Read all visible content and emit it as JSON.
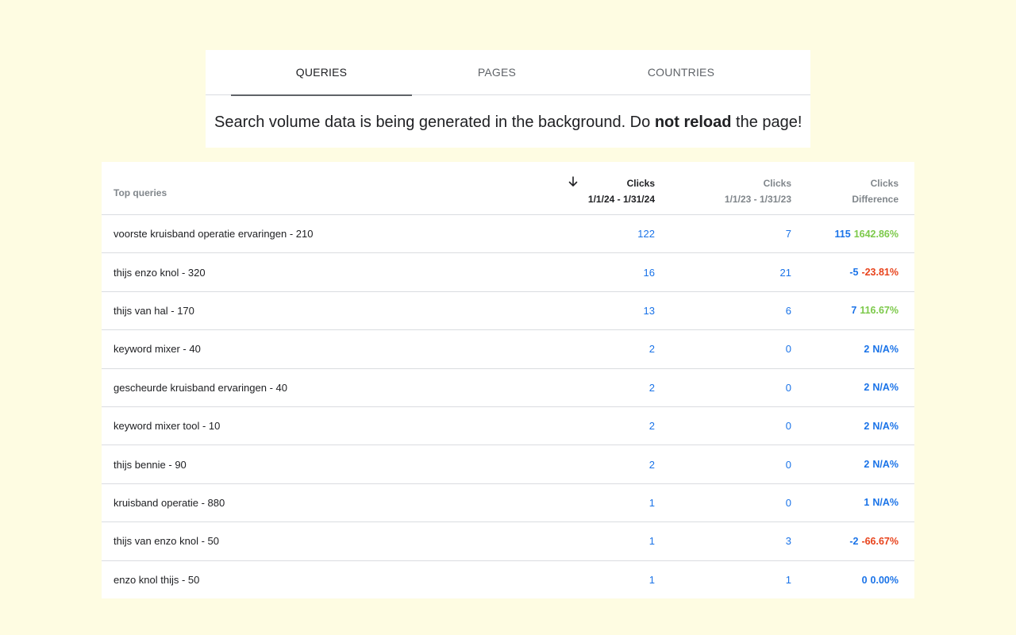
{
  "tabs": [
    {
      "label": "QUERIES",
      "active": true
    },
    {
      "label": "PAGES",
      "active": false
    },
    {
      "label": "COUNTRIES",
      "active": false
    }
  ],
  "notice": {
    "before": "Search volume data is being generated in the background. Do ",
    "bold": "not reload",
    "after": " the page!"
  },
  "table": {
    "header": {
      "query_label": "Top queries",
      "col1": {
        "title": "Clicks",
        "sub": "1/1/24 - 1/31/24"
      },
      "col2": {
        "title": "Clicks",
        "sub": "1/1/23 - 1/31/23"
      },
      "col3": {
        "title": "Clicks",
        "sub": "Difference"
      },
      "sort_icon": "arrow-down-icon"
    },
    "rows": [
      {
        "query": "voorste kruisband operatie ervaringen - 210",
        "clicks_current": "122",
        "clicks_previous": "7",
        "diff": "115",
        "pct": "1642.86%",
        "trend": "pos"
      },
      {
        "query": "thijs enzo knol - 320",
        "clicks_current": "16",
        "clicks_previous": "21",
        "diff": "-5",
        "pct": "-23.81%",
        "trend": "neg"
      },
      {
        "query": "thijs van hal - 170",
        "clicks_current": "13",
        "clicks_previous": "6",
        "diff": "7",
        "pct": "116.67%",
        "trend": "pos"
      },
      {
        "query": "keyword mixer - 40",
        "clicks_current": "2",
        "clicks_previous": "0",
        "diff": "2",
        "pct": "N/A%",
        "trend": "neutral"
      },
      {
        "query": "gescheurde kruisband ervaringen - 40",
        "clicks_current": "2",
        "clicks_previous": "0",
        "diff": "2",
        "pct": "N/A%",
        "trend": "neutral"
      },
      {
        "query": "keyword mixer tool - 10",
        "clicks_current": "2",
        "clicks_previous": "0",
        "diff": "2",
        "pct": "N/A%",
        "trend": "neutral"
      },
      {
        "query": "thijs bennie - 90",
        "clicks_current": "2",
        "clicks_previous": "0",
        "diff": "2",
        "pct": "N/A%",
        "trend": "neutral"
      },
      {
        "query": "kruisband operatie - 880",
        "clicks_current": "1",
        "clicks_previous": "0",
        "diff": "1",
        "pct": "N/A%",
        "trend": "neutral"
      },
      {
        "query": "thijs van enzo knol - 50",
        "clicks_current": "1",
        "clicks_previous": "3",
        "diff": "-2",
        "pct": "-66.67%",
        "trend": "neg"
      },
      {
        "query": "enzo knol thijs - 50",
        "clicks_current": "1",
        "clicks_previous": "1",
        "diff": "0",
        "pct": "0.00%",
        "trend": "neutral"
      }
    ]
  },
  "colors": {
    "background": "#fefce2",
    "link_blue": "#1a73e8",
    "positive": "#7cc94a",
    "negative": "#e8431c"
  }
}
